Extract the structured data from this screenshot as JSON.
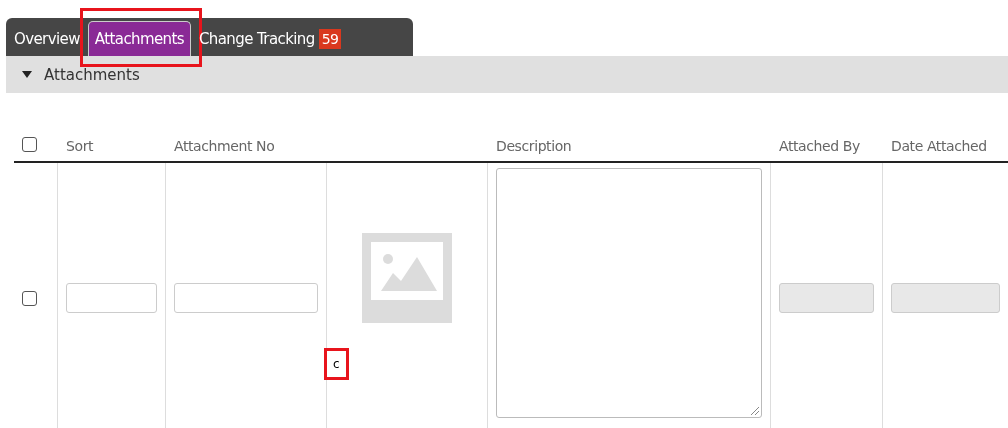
{
  "tabs": [
    {
      "label": "Overview",
      "selected": false,
      "highlighted": false
    },
    {
      "label": "Attachments",
      "selected": true,
      "highlighted": true
    },
    {
      "label": "Change Tracking",
      "selected": false,
      "highlighted": false,
      "badge": "59"
    }
  ],
  "section": {
    "title": "Attachments",
    "expanded": true
  },
  "table": {
    "select_all_checked": false,
    "columns": [
      "Sort",
      "Attachment No",
      "",
      "Description",
      "Attached By",
      "Date Attached"
    ],
    "rows": [
      {
        "checked": false,
        "caption": "c",
        "caption_highlighted": true
      }
    ]
  }
}
